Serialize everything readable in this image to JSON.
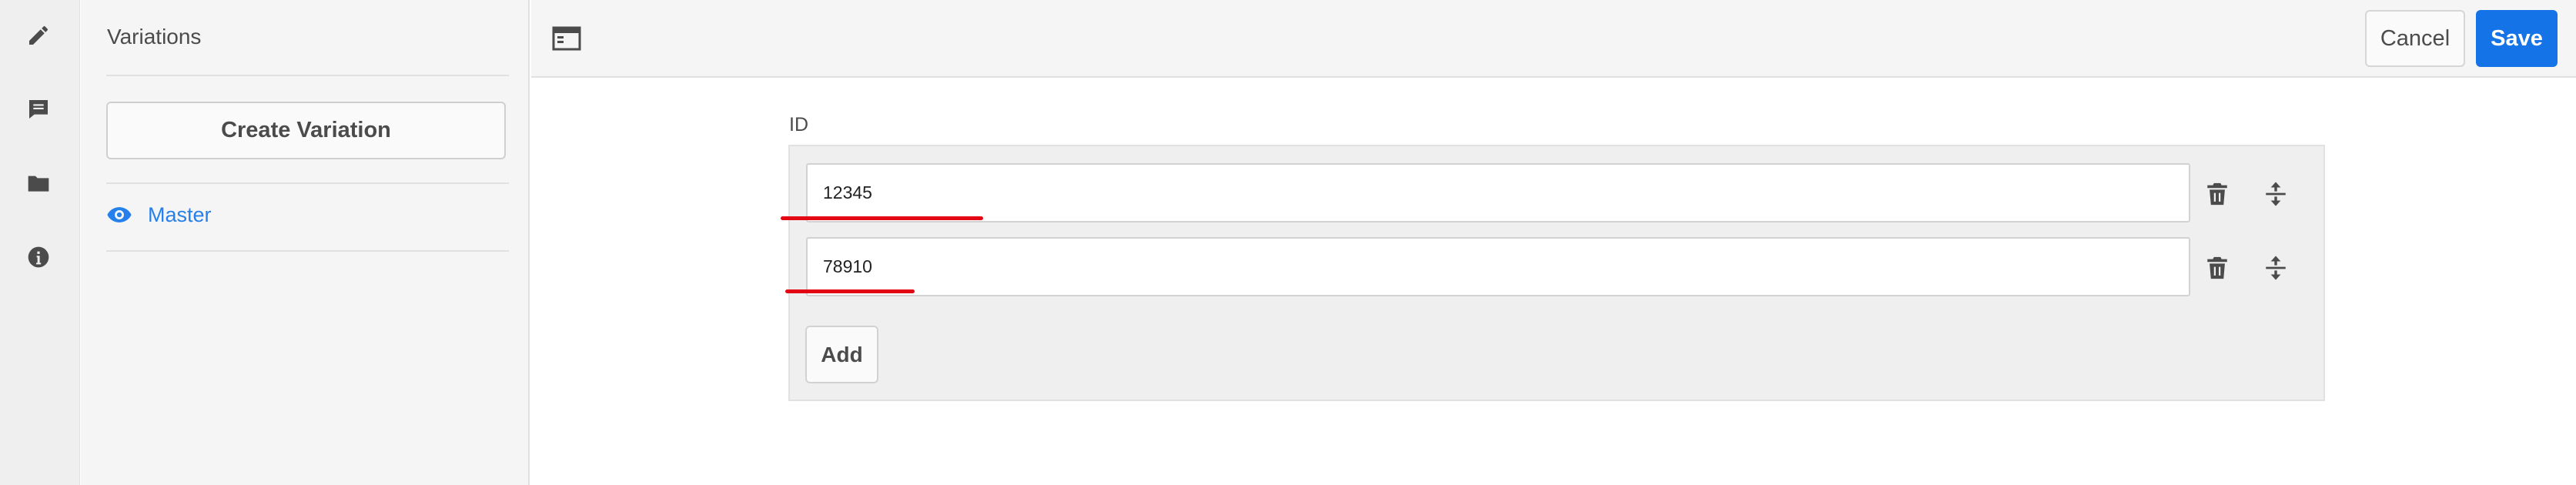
{
  "rail": {
    "items": [
      {
        "icon": "pencil-icon"
      },
      {
        "icon": "comment-icon"
      },
      {
        "icon": "folder-icon"
      },
      {
        "icon": "info-icon"
      }
    ]
  },
  "panel": {
    "title": "Variations",
    "create_label": "Create Variation",
    "master_label": "Master",
    "master_icon": "eye-icon"
  },
  "toolbar": {
    "layout_icon": "layout-toggle-icon",
    "cancel_label": "Cancel",
    "save_label": "Save"
  },
  "form": {
    "field_label": "ID",
    "items": [
      {
        "value": "12345"
      },
      {
        "value": "78910"
      }
    ],
    "add_label": "Add"
  },
  "colors": {
    "accent": "#1473e6",
    "link": "#2680eb",
    "annotation": "#e30613"
  }
}
